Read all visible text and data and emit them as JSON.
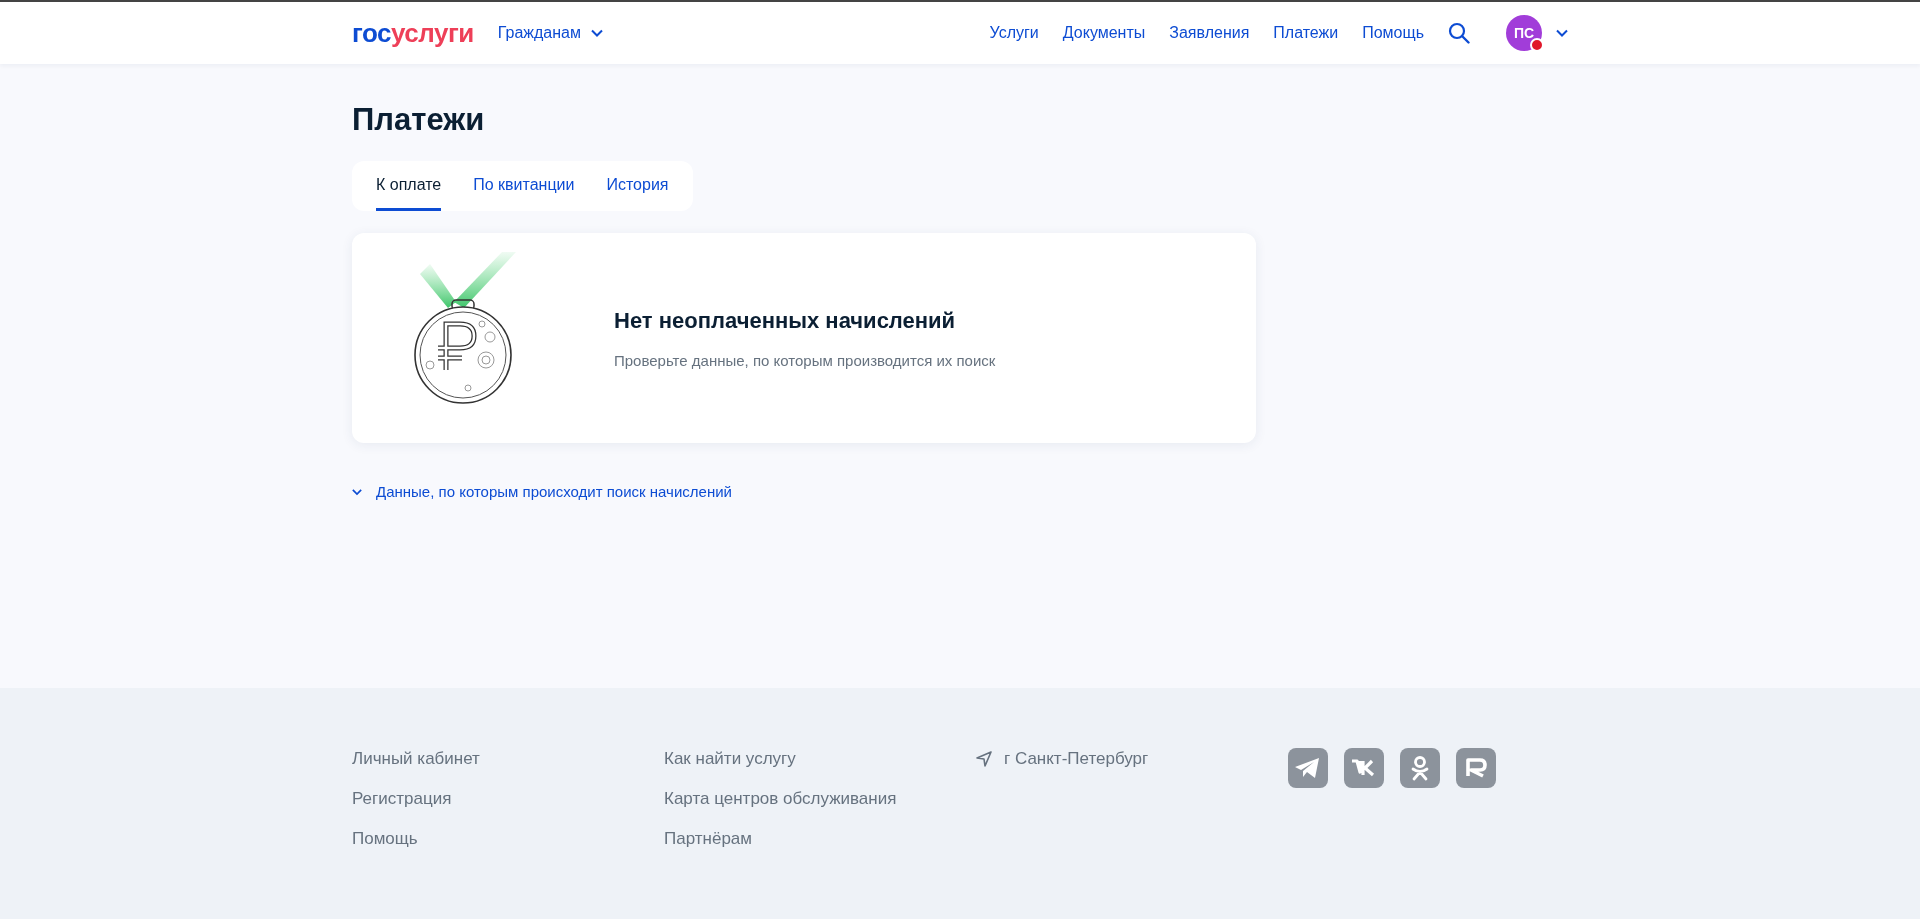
{
  "header": {
    "logo": [
      "гос",
      "услуги"
    ],
    "audience": {
      "label": "Гражданам",
      "expanded": false
    },
    "nav": [
      {
        "label": "Услуги"
      },
      {
        "label": "Документы"
      },
      {
        "label": "Заявления"
      },
      {
        "label": "Платежи"
      },
      {
        "label": "Помощь"
      }
    ],
    "avatar": {
      "initials": "ПС",
      "alert": true
    }
  },
  "page": {
    "title": "Платежи",
    "tabs": [
      {
        "label": "К оплате",
        "selected": true
      },
      {
        "label": "По квитанции",
        "selected": false
      },
      {
        "label": "История",
        "selected": false
      }
    ],
    "empty_state": {
      "title": "Нет неоплаченных начислений",
      "text": "Проверьте данные, по которым производится их поиск"
    },
    "details": {
      "label": "Данные, по которым происходит поиск начислений",
      "expanded": false
    }
  },
  "footer": {
    "columns": [
      [
        "Личный кабинет",
        "Регистрация",
        "Помощь"
      ],
      [
        "Как найти услугу",
        "Карта центров обслуживания",
        "Партнёрам"
      ]
    ],
    "location": "г Санкт-Петербург",
    "socials": [
      {
        "kind": "plane"
      },
      {
        "kind": "vk"
      },
      {
        "kind": "ok"
      },
      {
        "kind": "r"
      }
    ]
  }
}
